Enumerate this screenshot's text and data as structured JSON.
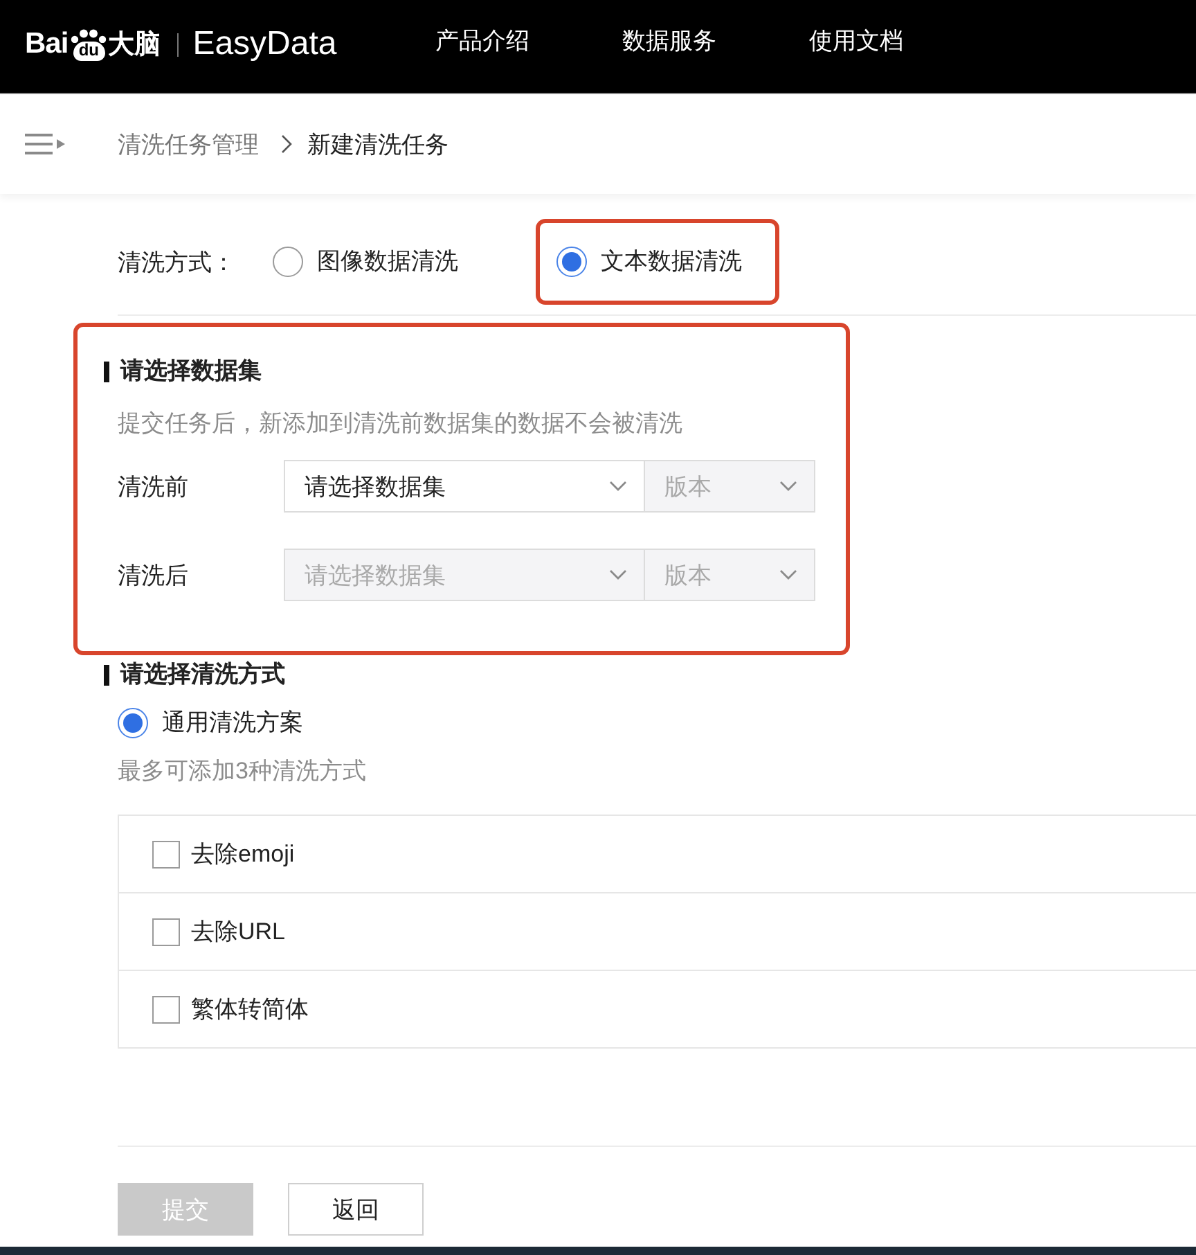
{
  "header": {
    "logo": {
      "brand": "Bai",
      "mark": "du",
      "brand_suffix": "大脑",
      "product": "EasyData"
    },
    "nav": [
      "产品介绍",
      "数据服务",
      "使用文档"
    ]
  },
  "breadcrumb": {
    "items": [
      {
        "label": "清洗任务管理",
        "current": false
      },
      {
        "label": "新建清洗任务",
        "current": true
      }
    ]
  },
  "cleaning_type": {
    "label": "清洗方式：",
    "options": [
      {
        "label": "图像数据清洗",
        "selected": false,
        "highlighted": false
      },
      {
        "label": "文本数据清洗",
        "selected": true,
        "highlighted": true
      }
    ]
  },
  "dataset_section": {
    "title": "请选择数据集",
    "highlighted": true,
    "hint": "提交任务后，新添加到清洗前数据集的数据不会被清洗",
    "rows": [
      {
        "label": "清洗前",
        "dataset": {
          "placeholder": "请选择数据集",
          "disabled": false
        },
        "version": {
          "placeholder": "版本",
          "disabled": true
        }
      },
      {
        "label": "清洗后",
        "dataset": {
          "placeholder": "请选择数据集",
          "disabled": true
        },
        "version": {
          "placeholder": "版本",
          "disabled": true
        }
      }
    ]
  },
  "method_section": {
    "title": "请选择清洗方式",
    "schemes": [
      {
        "label": "通用清洗方案",
        "selected": true
      }
    ],
    "hint": "最多可添加3种清洗方式",
    "options": [
      {
        "label": "去除emoji",
        "checked": false
      },
      {
        "label": "去除URL",
        "checked": false
      },
      {
        "label": "繁体转简体",
        "checked": false
      }
    ]
  },
  "buttons": [
    {
      "label": "提交",
      "kind": "primary",
      "disabled": true
    },
    {
      "label": "返回",
      "kind": "default",
      "disabled": false
    }
  ]
}
